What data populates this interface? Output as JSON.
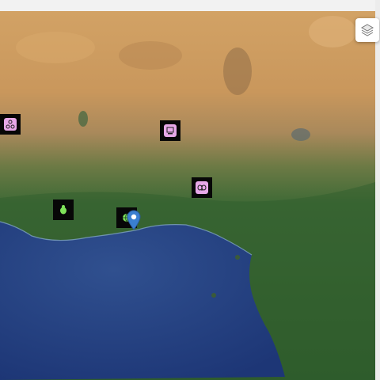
{
  "map": {
    "type": "satellite",
    "colors": {
      "desert": "#c99a5f",
      "sahel": "#a58a5a",
      "forest": "#3a6a35",
      "ocean": "#2c4a8e",
      "ocean_deep": "#1f3a7a",
      "marker_bg": "#070707",
      "marker_pink": "#e7a8e8",
      "marker_green": "#7fe35a",
      "pin": "#3a7fd0"
    }
  },
  "controls": {
    "layers_icon": "layers-icon"
  },
  "markers": [
    {
      "name": "marker-molecule-icon",
      "icon": "molecule-icon",
      "color": "pink"
    },
    {
      "name": "marker-screen-icon",
      "icon": "screen-icon",
      "color": "pink"
    },
    {
      "name": "marker-butterfly-icon",
      "icon": "butterfly-icon",
      "color": "pink"
    },
    {
      "name": "marker-bug-icon",
      "icon": "bug-icon",
      "color": "green"
    },
    {
      "name": "marker-globe-icon",
      "icon": "globe-icon",
      "color": "green"
    }
  ],
  "pin": {
    "icon": "location-pin-icon",
    "selected": true
  }
}
